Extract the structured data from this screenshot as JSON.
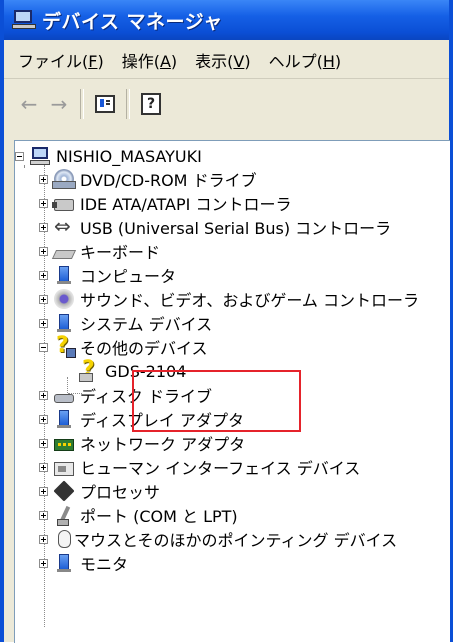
{
  "window": {
    "title": "デバイス マネージャ"
  },
  "menu": [
    {
      "label": "ファイル(",
      "accel": "F",
      "tail": ")"
    },
    {
      "label": "操作(",
      "accel": "A",
      "tail": ")"
    },
    {
      "label": "表示(",
      "accel": "V",
      "tail": ")"
    },
    {
      "label": "ヘルプ(",
      "accel": "H",
      "tail": ")"
    }
  ],
  "toolbar": {
    "back_glyph": "←",
    "forward_glyph": "→",
    "properties_icon": "properties-icon",
    "help_icon": "help-icon"
  },
  "tree": {
    "root": {
      "label": "NISHIO_MASAYUKI",
      "icon": "computer-icon"
    },
    "items": [
      {
        "label": "DVD/CD-ROM ドライブ",
        "icon": "cd-drive-icon"
      },
      {
        "label": "IDE ATA/ATAPI コントローラ",
        "icon": "ide-controller-icon"
      },
      {
        "label": "USB (Universal Serial Bus) コントローラ",
        "icon": "usb-icon"
      },
      {
        "label": "キーボード",
        "icon": "keyboard-icon"
      },
      {
        "label": "コンピュータ",
        "icon": "computer-blue-icon"
      },
      {
        "label": "サウンド、ビデオ、およびゲーム コントローラ",
        "icon": "sound-icon"
      },
      {
        "label": "システム デバイス",
        "icon": "system-device-icon"
      },
      {
        "label": "その他のデバイス",
        "icon": "unknown-device-icon",
        "expanded": true,
        "children": [
          {
            "label": "GDS-2104",
            "icon": "unknown-device-icon"
          }
        ]
      },
      {
        "label": "ディスク ドライブ",
        "icon": "disk-drive-icon"
      },
      {
        "label": "ディスプレイ アダプタ",
        "icon": "display-adapter-icon"
      },
      {
        "label": "ネットワーク アダプタ",
        "icon": "network-adapter-icon"
      },
      {
        "label": "ヒューマン インターフェイス デバイス",
        "icon": "hid-icon"
      },
      {
        "label": "プロセッサ",
        "icon": "processor-icon"
      },
      {
        "label": "ポート (COM と LPT)",
        "icon": "port-icon"
      },
      {
        "label": "マウスとそのほかのポインティング デバイス",
        "icon": "mouse-icon"
      },
      {
        "label": "モニタ",
        "icon": "monitor-icon"
      }
    ]
  },
  "colors": {
    "titlebar": "#0b4fd6",
    "highlight_box": "#e5232b"
  }
}
